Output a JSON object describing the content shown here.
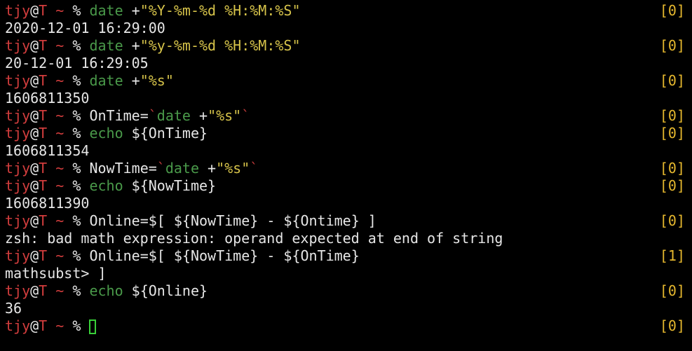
{
  "prompt": {
    "user": "tjy",
    "at": "@",
    "host": "T",
    "cwd": "~",
    "symbol": "%"
  },
  "lines": [
    {
      "type": "cmd",
      "status": "[0]",
      "parts": [
        {
          "text": "date",
          "color": "green"
        },
        {
          "text": " +",
          "color": "white"
        },
        {
          "text": "\"%Y-%m-%d %H:%M:%S\"",
          "color": "yellow"
        }
      ]
    },
    {
      "type": "out",
      "text": "2020-12-01 16:29:00"
    },
    {
      "type": "cmd",
      "status": "[0]",
      "parts": [
        {
          "text": "date",
          "color": "green"
        },
        {
          "text": " +",
          "color": "white"
        },
        {
          "text": "\"%y-%m-%d %H:%M:%S\"",
          "color": "yellow"
        }
      ]
    },
    {
      "type": "out",
      "text": "20-12-01 16:29:05"
    },
    {
      "type": "cmd",
      "status": "[0]",
      "parts": [
        {
          "text": "date",
          "color": "green"
        },
        {
          "text": " +",
          "color": "white"
        },
        {
          "text": "\"%s\"",
          "color": "yellow"
        }
      ]
    },
    {
      "type": "out",
      "text": "1606811350"
    },
    {
      "type": "cmd",
      "status": "[0]",
      "parts": [
        {
          "text": "OnTime=",
          "color": "white"
        },
        {
          "text": "`",
          "color": "red"
        },
        {
          "text": "date",
          "color": "green"
        },
        {
          "text": " +",
          "color": "white"
        },
        {
          "text": "\"%s\"",
          "color": "yellow"
        },
        {
          "text": "`",
          "color": "red"
        }
      ]
    },
    {
      "type": "cmd",
      "status": "[0]",
      "parts": [
        {
          "text": "echo",
          "color": "green"
        },
        {
          "text": " ${OnTime}",
          "color": "white"
        }
      ]
    },
    {
      "type": "out",
      "text": "1606811354"
    },
    {
      "type": "cmd",
      "status": "[0]",
      "parts": [
        {
          "text": "NowTime=",
          "color": "white"
        },
        {
          "text": "`",
          "color": "red"
        },
        {
          "text": "date",
          "color": "green"
        },
        {
          "text": " +",
          "color": "white"
        },
        {
          "text": "\"%s\"",
          "color": "yellow"
        },
        {
          "text": "`",
          "color": "red"
        }
      ]
    },
    {
      "type": "cmd",
      "status": "[0]",
      "parts": [
        {
          "text": "echo",
          "color": "green"
        },
        {
          "text": " ${NowTime}",
          "color": "white"
        }
      ]
    },
    {
      "type": "out",
      "text": "1606811390"
    },
    {
      "type": "cmd",
      "status": "[0]",
      "parts": [
        {
          "text": "Online=$[ ${NowTime} - ${Ontime} ]",
          "color": "white"
        }
      ]
    },
    {
      "type": "out",
      "text": "zsh: bad math expression: operand expected at end of string"
    },
    {
      "type": "cmd",
      "status": "[1]",
      "parts": [
        {
          "text": "Online=$[ ${NowTime} - ${OnTime}",
          "color": "white"
        }
      ]
    },
    {
      "type": "out",
      "text": "mathsubst> ]"
    },
    {
      "type": "cmd",
      "status": "[0]",
      "parts": [
        {
          "text": "echo",
          "color": "green"
        },
        {
          "text": " ${Online}",
          "color": "white"
        }
      ]
    },
    {
      "type": "out",
      "text": "36"
    },
    {
      "type": "input",
      "status": "[0]",
      "parts": []
    }
  ],
  "colors": {
    "background": "#000000",
    "prompt_red": "#d23d3d",
    "command_green": "#4a9a4a",
    "string_yellow": "#d6c34a",
    "status_yellow": "#e6b82e",
    "cursor_green": "#39d039",
    "text": "#e6e6e6"
  }
}
